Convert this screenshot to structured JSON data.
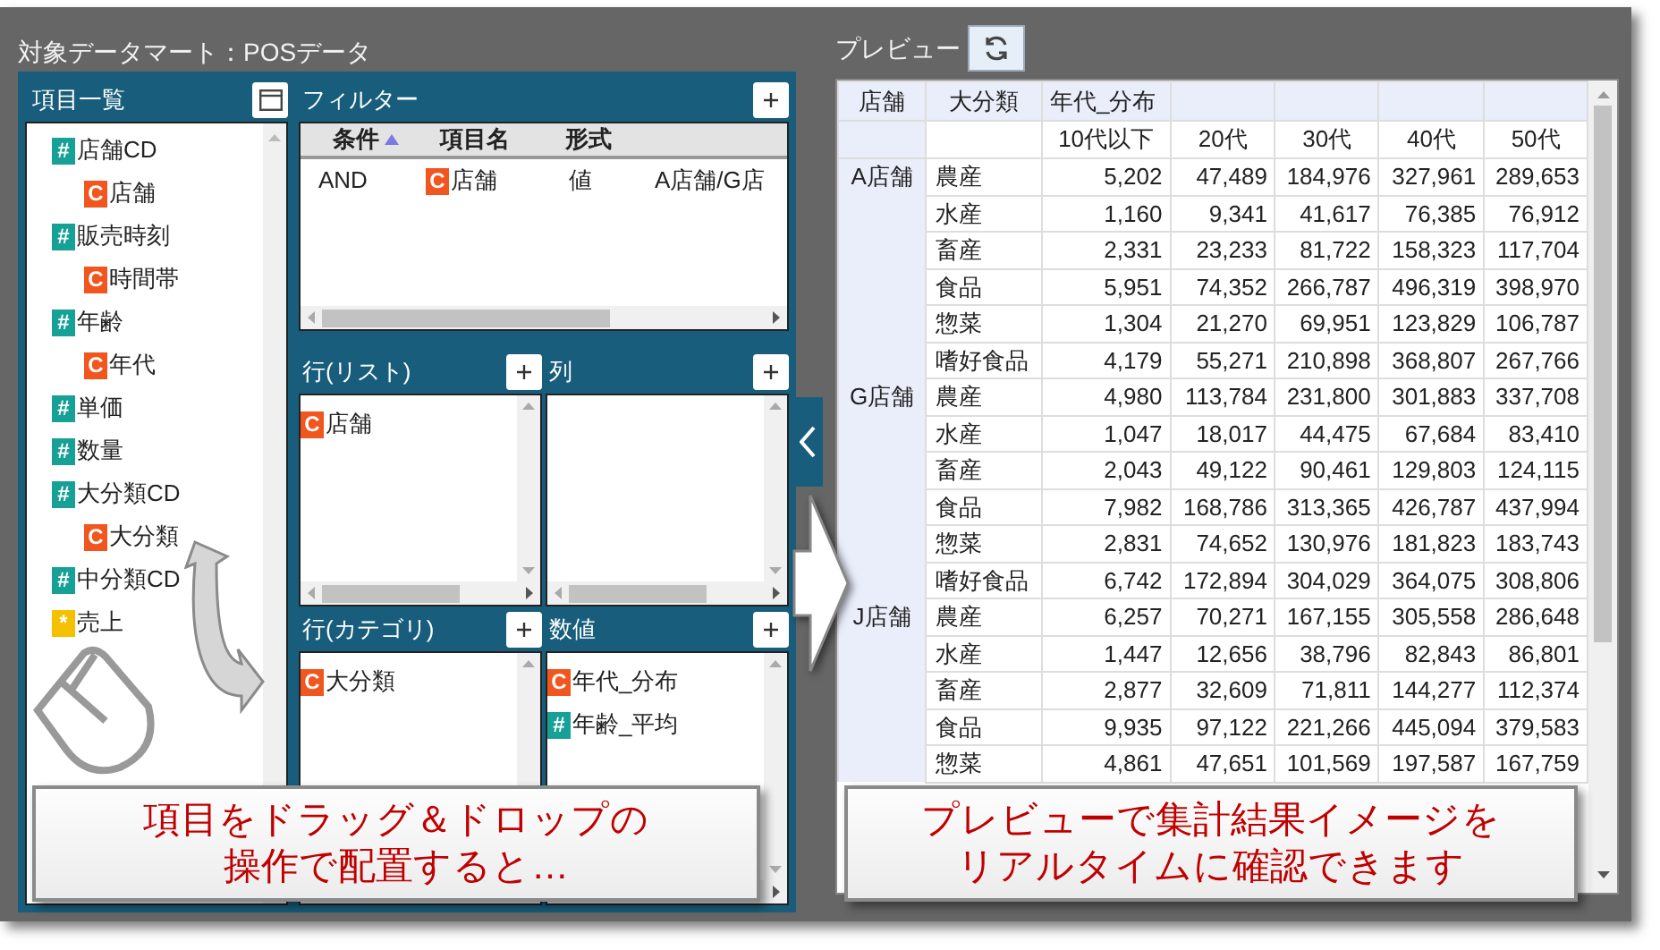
{
  "title": "対象データマート：POSデータ",
  "fields_panel": {
    "title": "項目一覧",
    "items": [
      {
        "kind": "number",
        "badge": "#",
        "label": "店舗CD",
        "children": [
          {
            "kind": "category",
            "badge": "C",
            "label": "店舗"
          }
        ]
      },
      {
        "kind": "number",
        "badge": "#",
        "label": "販売時刻",
        "children": [
          {
            "kind": "category",
            "badge": "C",
            "label": "時間帯"
          }
        ]
      },
      {
        "kind": "number",
        "badge": "#",
        "label": "年齢",
        "children": [
          {
            "kind": "category",
            "badge": "C",
            "label": "年代"
          }
        ]
      },
      {
        "kind": "number",
        "badge": "#",
        "label": "単価"
      },
      {
        "kind": "number",
        "badge": "#",
        "label": "数量"
      },
      {
        "kind": "number",
        "badge": "#",
        "label": "大分類CD",
        "children": [
          {
            "kind": "category",
            "badge": "C",
            "label": "大分類"
          }
        ]
      },
      {
        "kind": "number",
        "badge": "#",
        "label": "中分類CD"
      },
      {
        "kind": "measure",
        "badge": "*",
        "label": "売上"
      }
    ]
  },
  "filter": {
    "title": "フィルター",
    "columns": [
      {
        "label": "条件",
        "sorted": true
      },
      {
        "label": "項目名",
        "sorted": false
      },
      {
        "label": "形式",
        "sorted": false
      }
    ],
    "rows": [
      {
        "condition": "AND",
        "field": {
          "kind": "category",
          "badge": "C",
          "label": "店舗"
        },
        "format": "値",
        "value": "A店舗/G店"
      }
    ]
  },
  "row_list": {
    "title": "行(リスト)",
    "items": [
      {
        "kind": "category",
        "badge": "C",
        "label": "店舗"
      }
    ]
  },
  "columns": {
    "title": "列"
  },
  "row_categories": {
    "title": "行(カテゴリ)",
    "items": [
      {
        "kind": "category",
        "badge": "C",
        "label": "大分類"
      }
    ]
  },
  "values": {
    "title": "数値",
    "items": [
      {
        "kind": "category",
        "badge": "C",
        "label": "年代_分布"
      },
      {
        "kind": "number",
        "badge": "#",
        "label": "年齢_平均"
      }
    ]
  },
  "preview": {
    "title": "プレビュー",
    "header_row_1": [
      "店舗",
      "大分類",
      "年代_分布"
    ],
    "header_row_2": [
      "10代以下",
      "20代",
      "30代",
      "40代",
      "50代"
    ],
    "rows": [
      {
        "store": "A店舗",
        "category": "農産",
        "values": [
          "5,202",
          "47,489",
          "184,976",
          "327,961",
          "289,653"
        ]
      },
      {
        "category": "水産",
        "values": [
          "1,160",
          "9,341",
          "41,617",
          "76,385",
          "76,912"
        ]
      },
      {
        "category": "畜産",
        "values": [
          "2,331",
          "23,233",
          "81,722",
          "158,323",
          "117,704"
        ]
      },
      {
        "category": "食品",
        "values": [
          "5,951",
          "74,352",
          "266,787",
          "496,319",
          "398,970"
        ]
      },
      {
        "category": "惣菜",
        "values": [
          "1,304",
          "21,270",
          "69,951",
          "123,829",
          "106,787"
        ]
      },
      {
        "category": "嗜好食品",
        "values": [
          "4,179",
          "55,271",
          "210,898",
          "368,807",
          "267,766"
        ]
      },
      {
        "store": "G店舗",
        "category": "農産",
        "values": [
          "4,980",
          "113,784",
          "231,800",
          "301,883",
          "337,708"
        ]
      },
      {
        "category": "水産",
        "values": [
          "1,047",
          "18,017",
          "44,475",
          "67,684",
          "83,410"
        ]
      },
      {
        "category": "畜産",
        "values": [
          "2,043",
          "49,122",
          "90,461",
          "129,803",
          "124,115"
        ]
      },
      {
        "category": "食品",
        "values": [
          "7,982",
          "168,786",
          "313,365",
          "426,787",
          "437,994"
        ]
      },
      {
        "category": "惣菜",
        "values": [
          "2,831",
          "74,652",
          "130,976",
          "181,823",
          "183,743"
        ]
      },
      {
        "category": "嗜好食品",
        "values": [
          "6,742",
          "172,894",
          "304,029",
          "364,075",
          "308,806"
        ]
      },
      {
        "store": "J店舗",
        "category": "農産",
        "values": [
          "6,257",
          "70,271",
          "167,155",
          "305,558",
          "286,648"
        ]
      },
      {
        "category": "水産",
        "values": [
          "1,447",
          "12,656",
          "38,796",
          "82,843",
          "86,801"
        ]
      },
      {
        "category": "畜産",
        "values": [
          "2,877",
          "32,609",
          "71,811",
          "144,277",
          "112,374"
        ]
      },
      {
        "category": "食品",
        "values": [
          "9,935",
          "97,122",
          "221,266",
          "445,094",
          "379,583"
        ]
      },
      {
        "category": "惣菜",
        "values": [
          "4,861",
          "47,651",
          "101,569",
          "197,587",
          "167,759"
        ]
      }
    ]
  },
  "callouts": [
    {
      "lines": [
        "項目をドラッグ＆ドロップの",
        "操作で配置すると…"
      ]
    },
    {
      "lines": [
        "プレビューで集計結果イメージを",
        "リアルタイムに確認できます"
      ]
    }
  ]
}
